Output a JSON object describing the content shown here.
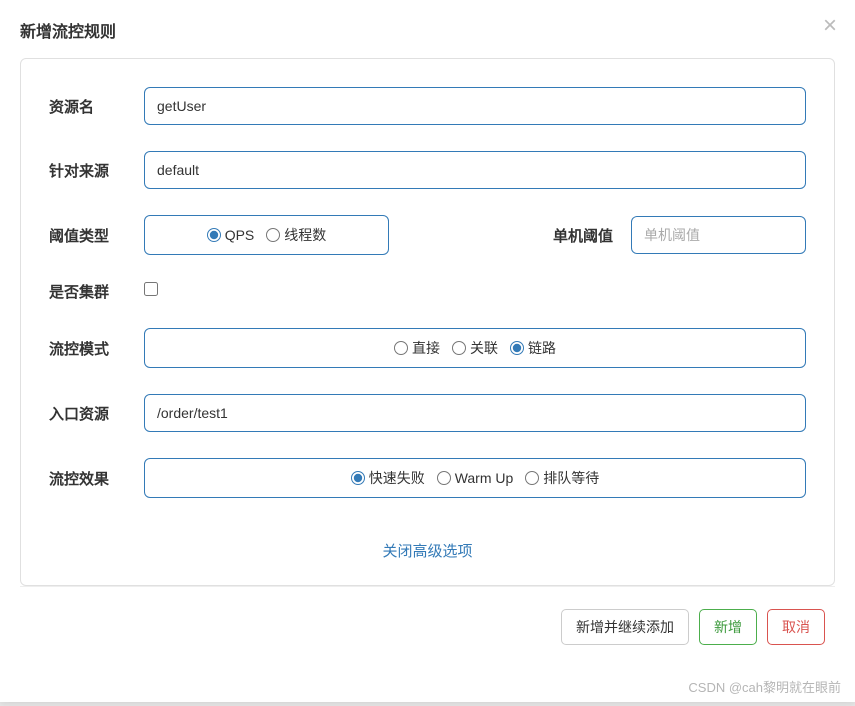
{
  "modal": {
    "title": "新增流控规则",
    "close_advanced_link": "关闭高级选项"
  },
  "labels": {
    "resource": "资源名",
    "source": "针对来源",
    "threshold_type": "阈值类型",
    "threshold_single": "单机阈值",
    "is_cluster": "是否集群",
    "flow_mode": "流控模式",
    "entry_resource": "入口资源",
    "flow_effect": "流控效果"
  },
  "values": {
    "resource": "getUser",
    "source": "default",
    "entry_resource": "/order/test1",
    "threshold_single": "",
    "is_cluster": false
  },
  "placeholders": {
    "threshold_single": "单机阈值"
  },
  "options": {
    "threshold_type": {
      "qps": "QPS",
      "threads": "线程数",
      "selected": "qps"
    },
    "flow_mode": {
      "direct": "直接",
      "relate": "关联",
      "chain": "链路",
      "selected": "chain"
    },
    "flow_effect": {
      "fail_fast": "快速失败",
      "warm_up": "Warm Up",
      "queue": "排队等待",
      "selected": "fail_fast"
    }
  },
  "buttons": {
    "add_continue": "新增并继续添加",
    "add": "新增",
    "cancel": "取消"
  },
  "watermark": "CSDN @cah黎明就在眼前"
}
